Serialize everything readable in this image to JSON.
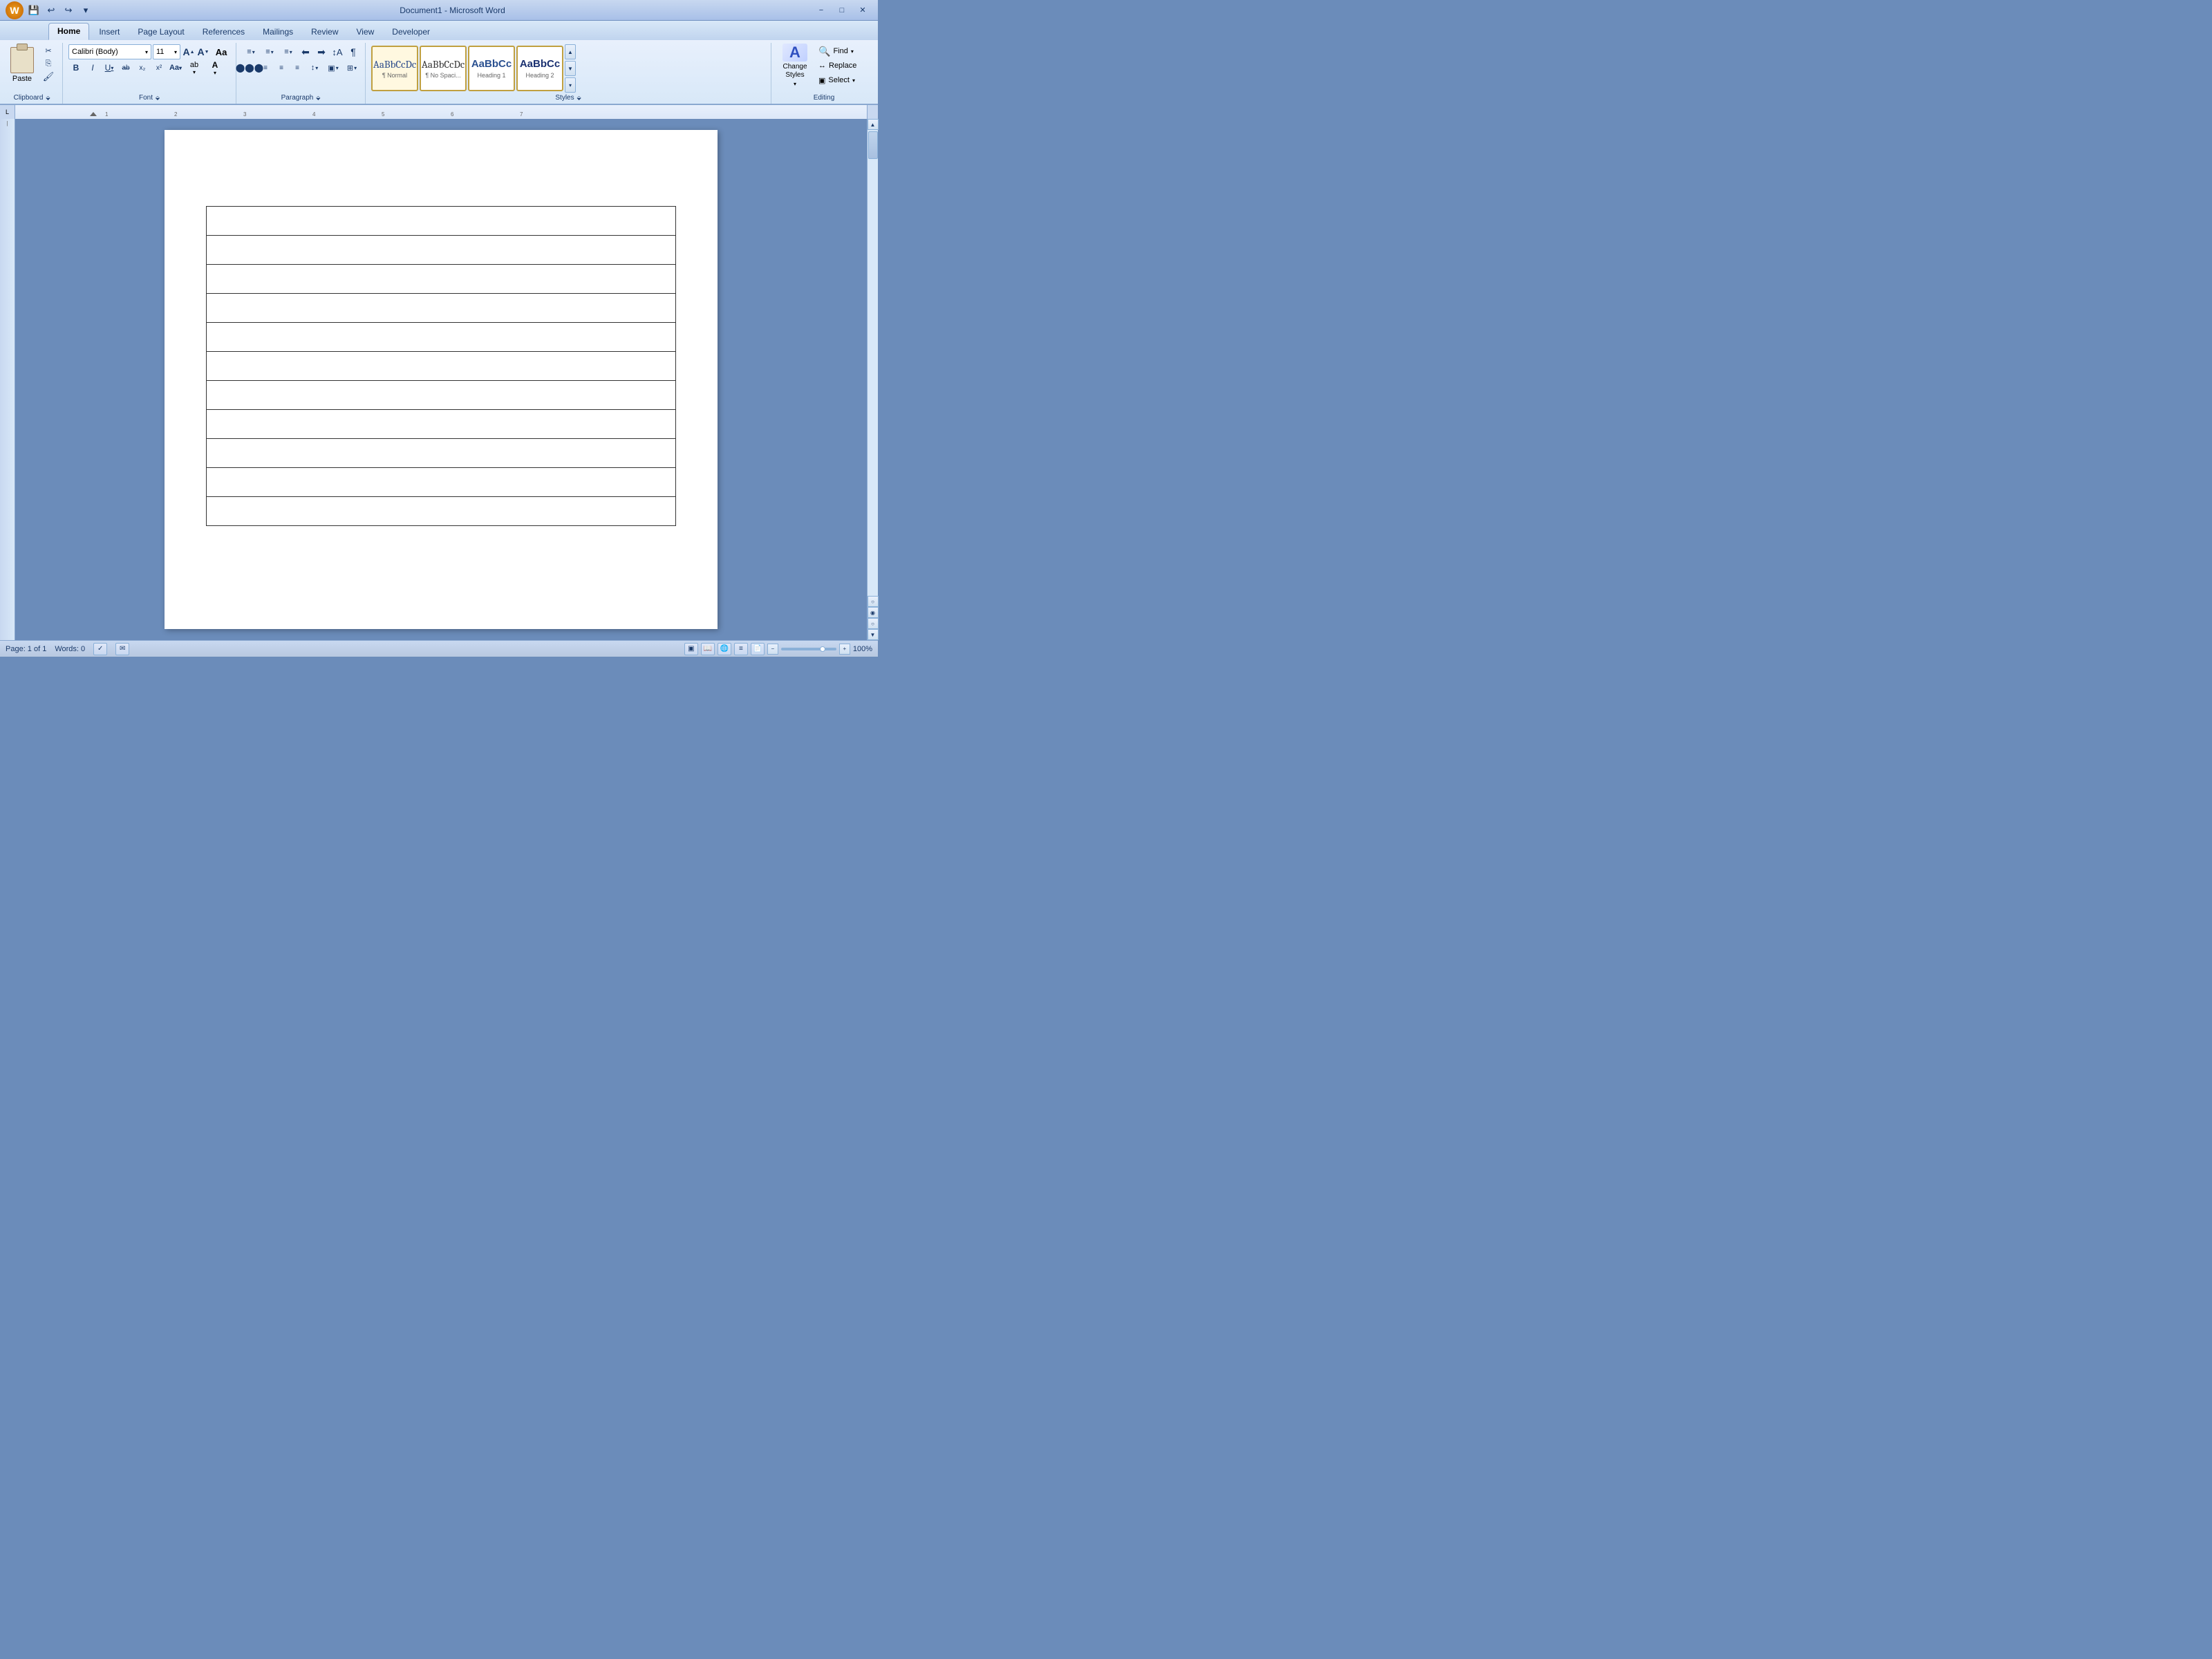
{
  "titlebar": {
    "title": "Document1 - Microsoft Word",
    "office_btn_label": "W",
    "quickaccess": {
      "save_label": "💾",
      "undo_label": "↩",
      "redo_label": "↪",
      "dropdown_label": "▾"
    },
    "controls": {
      "minimize": "−",
      "maximize": "□",
      "close": "✕"
    }
  },
  "ribbon": {
    "tabs": [
      "Home",
      "Insert",
      "Page Layout",
      "References",
      "Mailings",
      "Review",
      "View",
      "Developer"
    ],
    "active_tab": "Home",
    "groups": {
      "clipboard": {
        "label": "Clipboard",
        "paste_label": "Paste",
        "cut_label": "✂",
        "copy_label": "⎘",
        "format_painter_label": "🖌"
      },
      "font": {
        "label": "Font",
        "face": "Calibri (Body)",
        "size": "11",
        "grow_label": "A",
        "shrink_label": "A",
        "clear_label": "Aa",
        "bold_label": "B",
        "italic_label": "I",
        "underline_label": "U",
        "strikethrough_label": "ab",
        "subscript_label": "x₂",
        "superscript_label": "x²",
        "case_label": "Aa",
        "highlight_label": "ab",
        "color_label": "A"
      },
      "paragraph": {
        "label": "Paragraph",
        "bullets_label": "≡",
        "numbering_label": "≡",
        "multilevel_label": "≡",
        "decrease_indent_label": "⬅",
        "increase_indent_label": "➡",
        "sort_label": "↕",
        "marks_label": "¶",
        "align_left_label": "≡",
        "align_center_label": "≡",
        "align_right_label": "≡",
        "align_justify_label": "≡",
        "line_spacing_label": "↕",
        "shading_label": "▣",
        "borders_label": "⊞"
      },
      "styles": {
        "label": "Styles",
        "items": [
          {
            "preview": "AaBbCcDc",
            "label": "¶ Normal",
            "type": "normal"
          },
          {
            "preview": "AaBbCcDc",
            "label": "¶ No Spaci...",
            "type": "nospace"
          },
          {
            "preview": "AaBbCc",
            "label": "Heading 1",
            "type": "heading1"
          },
          {
            "preview": "AaBbCc",
            "label": "Heading 2",
            "type": "heading2"
          }
        ],
        "expand_label": "▾"
      },
      "editing": {
        "label": "Editing",
        "find_label": "Find",
        "replace_label": "Replace",
        "select_label": "Select",
        "change_styles_label": "Change\nStyles",
        "change_styles_icon": "A"
      }
    }
  },
  "ruler": {
    "indent_marker": "▾",
    "marks": [
      "1",
      "2",
      "3",
      "4",
      "5",
      "6",
      "7"
    ]
  },
  "document": {
    "table": {
      "rows": 11,
      "cols": 1
    }
  },
  "statusbar": {
    "page_label": "Page: 1 of 1",
    "words_label": "Words: 0",
    "spell_check_label": "✓",
    "zoom_level": "100%",
    "zoom_minus": "−",
    "zoom_plus": "+"
  }
}
